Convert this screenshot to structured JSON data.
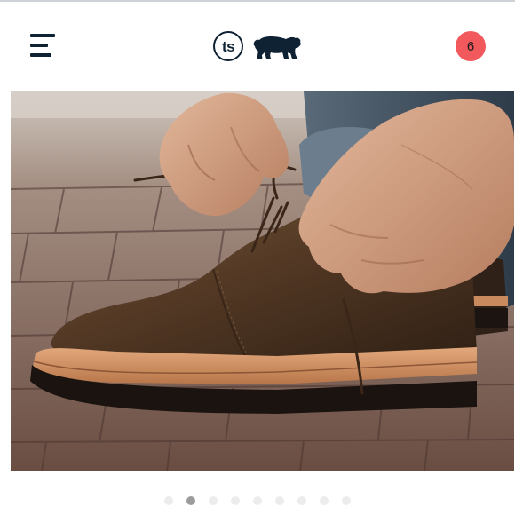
{
  "header": {
    "menu_icon": "hamburger-menu-icon",
    "logo_text": "ts",
    "logo_icon": "bear-icon",
    "cart_count": "6",
    "cart_color": "#f1595d",
    "brand_color": "#0f2233"
  },
  "gallery": {
    "image_subject": "product-photo-suede-chukka-boot",
    "slide_count": 9,
    "active_slide": 2
  }
}
